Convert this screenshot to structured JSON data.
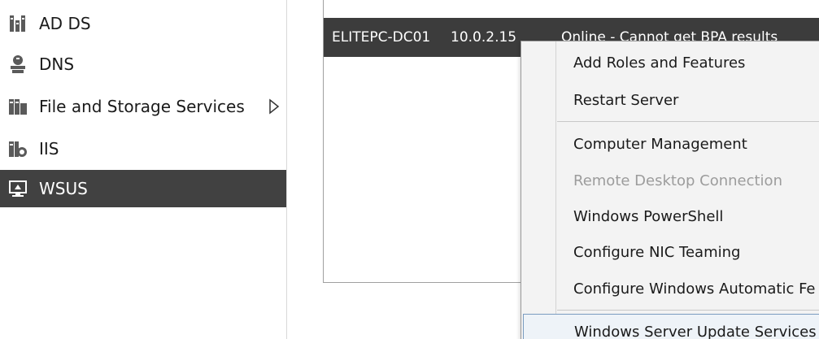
{
  "nav": {
    "items": [
      {
        "label": "AD DS",
        "icon": "ad-ds-icon"
      },
      {
        "label": "DNS",
        "icon": "dns-icon"
      },
      {
        "label": "File and Storage Services",
        "icon": "file-storage-icon",
        "has_submenu": true
      },
      {
        "label": "IIS",
        "icon": "iis-icon"
      },
      {
        "label": "WSUS",
        "icon": "wsus-icon",
        "selected": true
      }
    ]
  },
  "servers": {
    "rows": [
      {
        "name": "ELITEPC-DC01",
        "ip": "10.0.2.15",
        "status": "Online - Cannot get BPA results"
      }
    ]
  },
  "context_menu": {
    "items": [
      {
        "label": "Add Roles and Features",
        "enabled": true
      },
      {
        "label": "Restart Server",
        "enabled": true
      },
      {
        "label": "Computer Management",
        "enabled": true
      },
      {
        "label": "Remote Desktop Connection",
        "enabled": false
      },
      {
        "label": "Windows PowerShell",
        "enabled": true
      },
      {
        "label": "Configure NIC Teaming",
        "enabled": true
      },
      {
        "label": "Configure Windows Automatic Fe",
        "enabled": true
      },
      {
        "label": "Windows Server Update Services",
        "enabled": true,
        "highlighted": true
      }
    ]
  },
  "colors": {
    "selected_bg": "#414141",
    "row_selected_bg": "#3c3c3c",
    "menu_bg": "#f3f3f3",
    "disabled_text": "#9c9c9c"
  }
}
